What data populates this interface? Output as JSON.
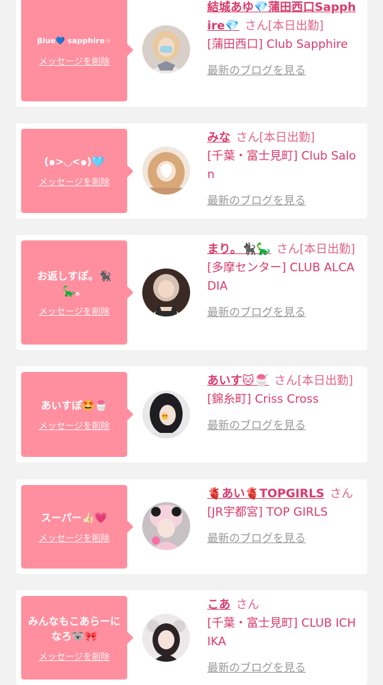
{
  "common": {
    "delete_label": "メッセージを削除",
    "blog_label": "最新のブログを見る",
    "honorific": "さん"
  },
  "colors": {
    "bubble": "#ff8f9f",
    "accent": "#d93b6a",
    "link_gray": "#999999"
  },
  "entries": [
    {
      "message": "βlue💙 sapphire☆",
      "name": "結城あゆ💎蒲田西口Sapphire💎",
      "status": "[本日出勤]",
      "shop": "[蒲田西口] Club Sapphire",
      "avatar_icon": "girl-photo-icon"
    },
    {
      "message": "(๑>◡<๑)🩵",
      "name": "みな",
      "status": "[本日出勤]",
      "shop": "[千葉・富士見町] Club Salon",
      "avatar_icon": "girl-photo-icon"
    },
    {
      "message": "お返しすぽ。🐈‍⬛🦕。",
      "name": "まり。🐈‍⬛🦕",
      "status": "[本日出勤]",
      "shop": "[多摩センター] CLUB ALCADIA",
      "avatar_icon": "girl-photo-icon"
    },
    {
      "message": "あいすぽ🤩🍧",
      "name": "あいす🐱🍧",
      "status": "[本日出勤]",
      "shop": "[錦糸町] Criss Cross",
      "avatar_icon": "girl-photo-icon"
    },
    {
      "message": "スーパー👍🏻💗",
      "name": "🫀あい🫀TOPGIRLS",
      "status": "",
      "shop": "[JR宇都宮] TOP GIRLS",
      "avatar_icon": "girl-photo-icon"
    },
    {
      "message": "みんなもこあらーになろ🐨🎀",
      "name": "こあ",
      "status": "",
      "shop": "[千葉・富士見町] CLUB ICHIKA",
      "avatar_icon": "girl-photo-icon"
    }
  ]
}
